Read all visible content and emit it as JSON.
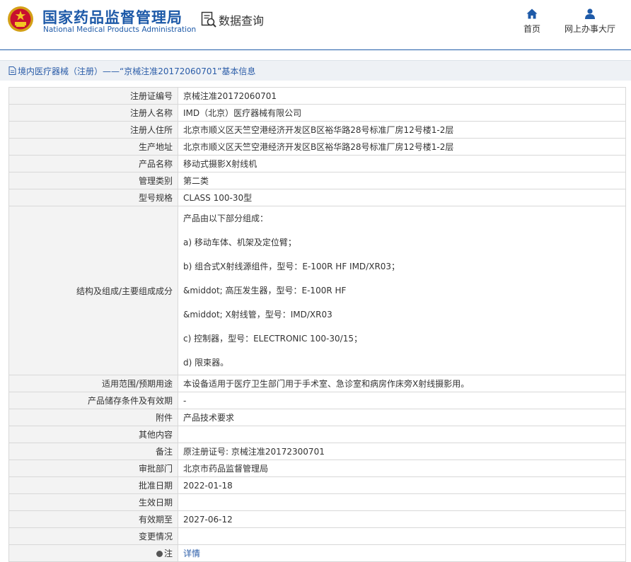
{
  "brand": {
    "cn": "国家药品监督管理局",
    "en": "National Medical Products Administration"
  },
  "query": {
    "label": "数据查询",
    "icon": "search-document-icon"
  },
  "nav": {
    "home": "首页",
    "hall": "网上办事大厅"
  },
  "breadcrumb": {
    "text": "境内医疗器械（注册）——“京械注准20172060701”基本信息",
    "icon": "document-icon"
  },
  "rows": [
    {
      "label": "注册证编号",
      "value": "京械注准20172060701"
    },
    {
      "label": "注册人名称",
      "value": "IMD（北京）医疗器械有限公司"
    },
    {
      "label": "注册人住所",
      "value": "北京市顺义区天竺空港经济开发区B区裕华路28号标准厂房12号楼1-2层"
    },
    {
      "label": "生产地址",
      "value": "北京市顺义区天竺空港经济开发区B区裕华路28号标准厂房12号楼1-2层"
    },
    {
      "label": "产品名称",
      "value": "移动式摄影X射线机"
    },
    {
      "label": "管理类别",
      "value": "第二类"
    },
    {
      "label": "型号规格",
      "value": "CLASS 100-30型"
    }
  ],
  "structure": {
    "label": "结构及组成/主要组成成分",
    "lines": [
      "产品由以下部分组成：",
      "a) 移动车体、机架及定位臂；",
      "b) 组合式X射线源组件，型号：E-100R HF IMD/XR03；",
      "&middot; 高压发生器，型号：E-100R HF",
      "&middot; X射线管，型号：IMD/XR03",
      "c) 控制器，型号：ELECTRONIC 100-30/15；",
      "d) 限束器。"
    ]
  },
  "rows2": [
    {
      "label": "适用范围/预期用途",
      "value": "本设备适用于医疗卫生部门用于手术室、急诊室和病房作床旁X射线摄影用。"
    },
    {
      "label": "产品储存条件及有效期",
      "value": "-"
    },
    {
      "label": "附件",
      "value": "产品技术要求"
    },
    {
      "label": "其他内容",
      "value": ""
    },
    {
      "label": "备注",
      "value": "原注册证号: 京械注准20172300701"
    },
    {
      "label": "审批部门",
      "value": "北京市药品监督管理局"
    },
    {
      "label": "批准日期",
      "value": "2022-01-18"
    },
    {
      "label": "生效日期",
      "value": ""
    },
    {
      "label": "有效期至",
      "value": "2027-06-12"
    },
    {
      "label": "变更情况",
      "value": ""
    }
  ],
  "note": {
    "label": "注",
    "link": "详情"
  },
  "colors": {
    "brand": "#1e5aa8",
    "link": "#2a5ca8",
    "label_bg": "#f3f3f3",
    "border": "#d8d8d8"
  }
}
